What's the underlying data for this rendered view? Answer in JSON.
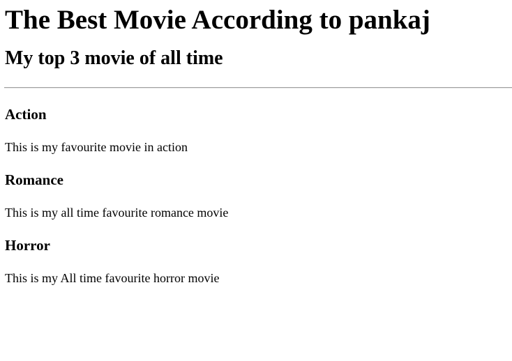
{
  "page": {
    "title": "The Best Movie According to pankaj",
    "subtitle": "My top 3 movie of all time"
  },
  "genres": [
    {
      "heading": "Action",
      "description": "This is my favourite movie in action"
    },
    {
      "heading": "Romance",
      "description": "This is my all time favourite romance movie"
    },
    {
      "heading": "Horror",
      "description": "This is my All time favourite horror movie"
    }
  ]
}
